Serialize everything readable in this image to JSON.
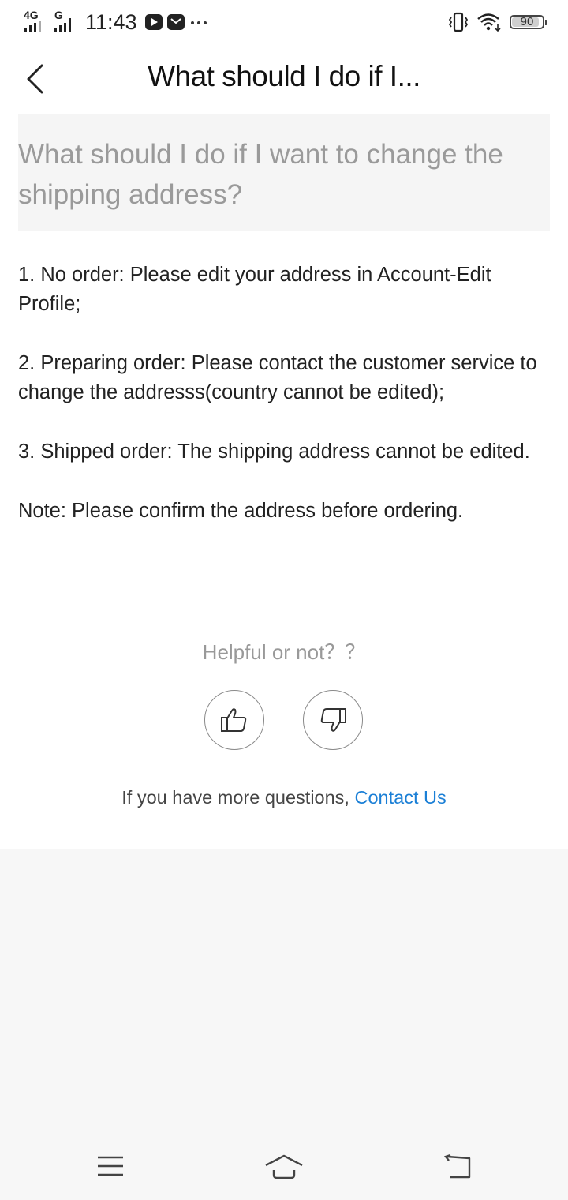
{
  "status_bar": {
    "network_1": "4G",
    "network_2": "G",
    "time": "11:43",
    "battery": "90",
    "battery_level": 0.9
  },
  "header": {
    "title": "What should I do if I..."
  },
  "question": "What should I do if I want to change the shipping address?",
  "answer": [
    "1. No order: Please edit your address in Account-Edit Profile;",
    "2. Preparing order: Please contact the customer service to change the addresss(country cannot be edited);",
    "3. Shipped order: The shipping address cannot be edited.",
    "Note: Please confirm the address before ordering."
  ],
  "feedback": {
    "prompt": "Helpful or not？？",
    "icons": [
      "thumbs-up-icon",
      "thumbs-down-icon"
    ]
  },
  "contact": {
    "text": "If you have more questions, ",
    "link": "Contact Us",
    "link_color": "#1a7fd6"
  },
  "nav_icons": [
    "menu-icon",
    "home-icon",
    "back-nav-icon"
  ]
}
